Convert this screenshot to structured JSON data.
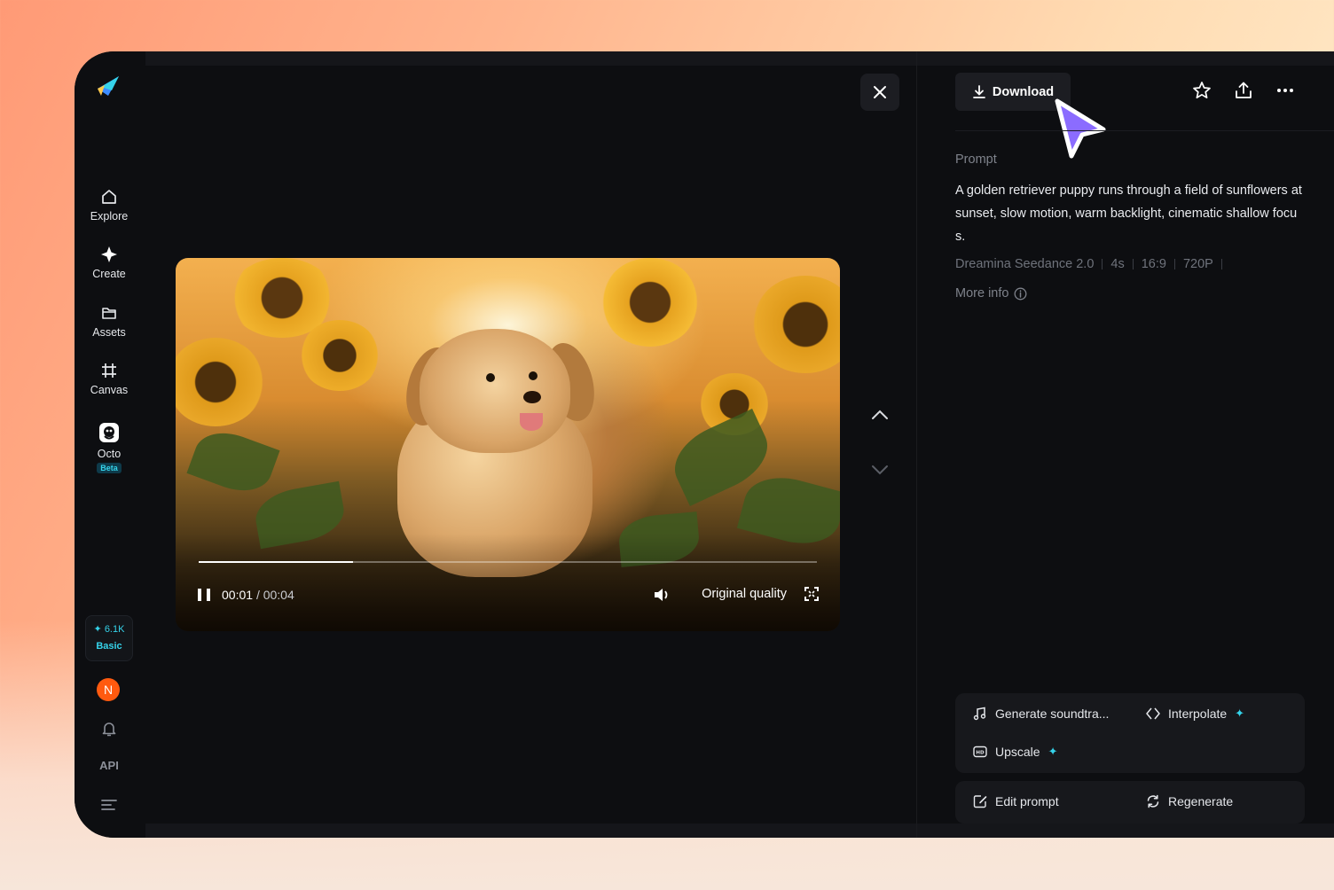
{
  "sidebar": {
    "items": [
      {
        "label": "Explore",
        "icon": "home-icon"
      },
      {
        "label": "Create",
        "icon": "sparkle-icon"
      },
      {
        "label": "Assets",
        "icon": "folder-icon"
      },
      {
        "label": "Canvas",
        "icon": "canvas-icon"
      },
      {
        "label": "Octo",
        "icon": "octo-icon",
        "badge": "Beta"
      }
    ],
    "credits": {
      "amount": "6.1K",
      "plan": "Basic"
    },
    "avatar_initial": "N",
    "api_label": "API"
  },
  "player": {
    "current_time": "00:01",
    "duration": "/ 00:04",
    "progress_fraction": 0.25,
    "quality_label": "Original quality"
  },
  "panel": {
    "download_label": "Download",
    "prompt_label": "Prompt",
    "prompt_text": "A golden retriever puppy runs through a field of sunflowers at sunset, slow motion, warm backlight, cinematic shallow focus.",
    "meta": {
      "model": "Dreamina Seedance 2.0",
      "duration": "4s",
      "ratio": "16:9",
      "resolution": "720P"
    },
    "more_info": "More info",
    "tools": {
      "soundtrack": "Generate soundtra...",
      "interpolate": "Interpolate",
      "upscale": "Upscale"
    },
    "edit_prompt": "Edit prompt",
    "regenerate": "Regenerate"
  },
  "colors": {
    "accent": "#35d3ea",
    "avatar": "#ff5a0f",
    "cursor": "#8b6cff"
  }
}
